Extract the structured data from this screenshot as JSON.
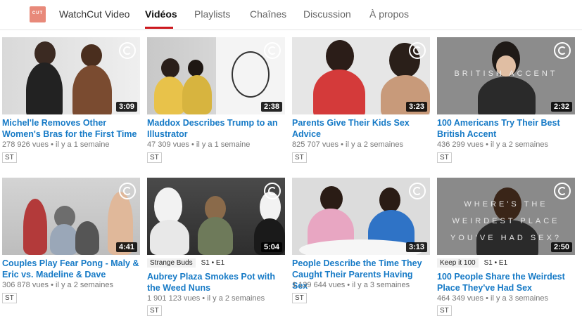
{
  "channel": {
    "name": "WatchCut Video",
    "logo_text": "CUT",
    "logo_color": "#e8897a"
  },
  "tabs": [
    {
      "label": "Vidéos",
      "active": true
    },
    {
      "label": "Playlists",
      "active": false
    },
    {
      "label": "Chaînes",
      "active": false
    },
    {
      "label": "Discussion",
      "active": false
    },
    {
      "label": "À propos",
      "active": false
    }
  ],
  "accent_color": "#cc181e",
  "link_color": "#167ac6",
  "videos": [
    {
      "title": "Michel'le Removes Other Women's Bras for the First Time",
      "duration": "3:09",
      "views": "278 926 vues",
      "age": "il y a 1 semaine",
      "badge": "ST"
    },
    {
      "title": "Maddox Describes Trump to an Illustrator",
      "duration": "2:38",
      "views": "47 309 vues",
      "age": "il y a 1 semaine",
      "badge": "ST"
    },
    {
      "title": "Parents Give Their Kids Sex Advice",
      "duration": "3:23",
      "views": "825 707 vues",
      "age": "il y a 2 semaines",
      "badge": "ST"
    },
    {
      "title": "100 Americans Try Their Best British Accent",
      "duration": "2:32",
      "views": "436 299 vues",
      "age": "il y a 2 semaines",
      "badge": "ST",
      "overlay_text": "BRITISH ACCENT"
    },
    {
      "title": "Couples Play Fear Pong - Maly & Eric vs. Madeline & Dave",
      "duration": "4:41",
      "views": "306 878 vues",
      "age": "il y a 2 semaines",
      "badge": "ST"
    },
    {
      "title": "Aubrey Plaza Smokes Pot with the Weed Nuns",
      "duration": "5:04",
      "views": "1 901 123 vues",
      "age": "il y a 2 semaines",
      "badge": "ST",
      "playlist": "Strange Buds",
      "episode": "S1 • E1"
    },
    {
      "title": "People Describe the Time They Caught Their Parents Having Sex",
      "duration": "3:13",
      "views": "1 139 644 vues",
      "age": "il y a 3 semaines",
      "badge": "ST"
    },
    {
      "title": "100 People Share the Weirdest Place They've Had Sex",
      "duration": "2:50",
      "views": "464 349 vues",
      "age": "il y a 3 semaines",
      "badge": "ST",
      "playlist": "Keep it 100",
      "episode": "S1 • E1",
      "overlay_lines": [
        "WHERE'S THE",
        "WEIRDEST PLACE",
        "YOU'VE HAD SEX?"
      ]
    }
  ]
}
